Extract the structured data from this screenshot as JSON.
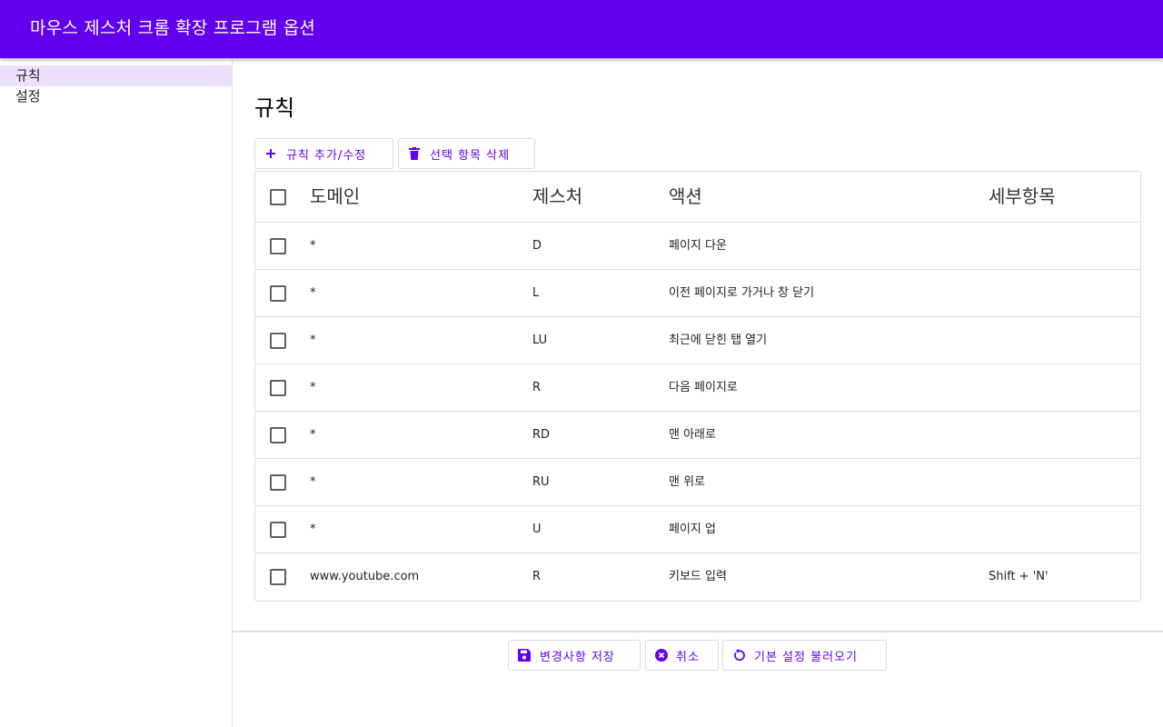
{
  "app": {
    "title": "마우스 제스처 크롬 확장 프로그램 옵션"
  },
  "sidebar": {
    "items": [
      {
        "label": "규칙"
      },
      {
        "label": "설정"
      }
    ]
  },
  "main": {
    "title": "규칙",
    "toolbar": {
      "add_label": "규칙 추가/수정",
      "delete_label": "선택 항목 삭제"
    },
    "table": {
      "columns": [
        "도메인",
        "제스처",
        "액션",
        "세부항목"
      ],
      "rows": [
        {
          "domain": "*",
          "gesture": "D",
          "action": "페이지 다운",
          "detail": ""
        },
        {
          "domain": "*",
          "gesture": "L",
          "action": "이전 페이지로 가거나 창 닫기",
          "detail": ""
        },
        {
          "domain": "*",
          "gesture": "LU",
          "action": "최근에 닫힌 탭 열기",
          "detail": ""
        },
        {
          "domain": "*",
          "gesture": "R",
          "action": "다음 페이지로",
          "detail": ""
        },
        {
          "domain": "*",
          "gesture": "RD",
          "action": "맨 아래로",
          "detail": ""
        },
        {
          "domain": "*",
          "gesture": "RU",
          "action": "맨 위로",
          "detail": ""
        },
        {
          "domain": "*",
          "gesture": "U",
          "action": "페이지 업",
          "detail": ""
        },
        {
          "domain": "www.youtube.com",
          "gesture": "R",
          "action": "키보드 입력",
          "detail": "Shift + 'N'"
        }
      ]
    },
    "footer": {
      "save_label": "변경사항 저장",
      "cancel_label": "취소",
      "reset_label": "기본 설정 불러오기"
    }
  },
  "colors": {
    "primary": "#6200ee",
    "nav_active": "#ede0fd"
  },
  "icons": {
    "add": "plus-icon",
    "delete": "trash-icon",
    "save": "floppy-icon",
    "cancel": "close-circle-icon",
    "reset": "refresh-icon"
  }
}
